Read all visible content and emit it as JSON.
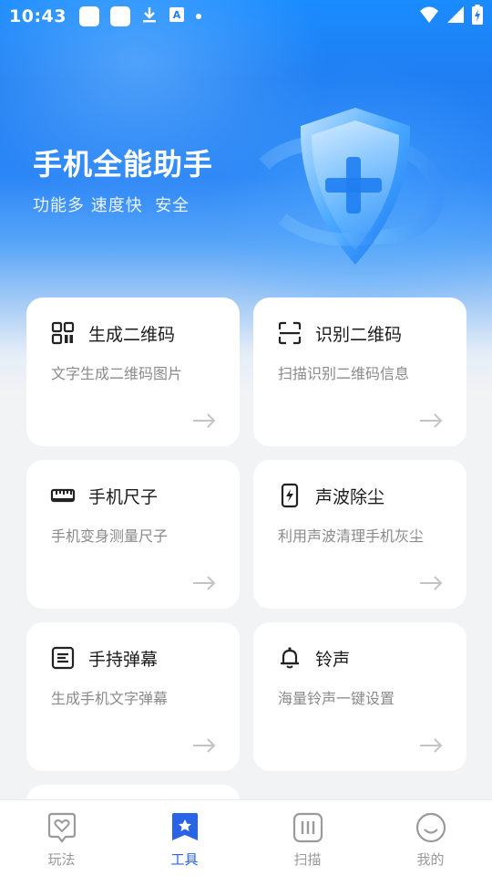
{
  "status_bar": {
    "time": "10:43",
    "left_icons": [
      "app-square-icon",
      "app-square-icon",
      "download-icon",
      "a-text-icon",
      "dot-icon"
    ],
    "right_icons": [
      "wifi-icon",
      "signal-icon",
      "battery-charging-icon"
    ]
  },
  "hero": {
    "title": "手机全能助手",
    "subtitle": "功能多 速度快  安全",
    "illustration": "shield-plus-icon"
  },
  "tools": [
    {
      "icon": "qr-code-icon",
      "title": "生成二维码",
      "desc": "文字生成二维码图片"
    },
    {
      "icon": "scan-qr-icon",
      "title": "识别二维码",
      "desc": "扫描识别二维码信息"
    },
    {
      "icon": "ruler-icon",
      "title": "手机尺子",
      "desc": "手机变身测量尺子"
    },
    {
      "icon": "phone-lightning-icon",
      "title": "声波除尘",
      "desc": "利用声波清理手机灰尘"
    },
    {
      "icon": "barrage-icon",
      "title": "手持弹幕",
      "desc": "生成手机文字弹幕"
    },
    {
      "icon": "bell-icon",
      "title": "铃声",
      "desc": "海量铃声一键设置"
    }
  ],
  "tabbar": {
    "items": [
      {
        "label": "玩法",
        "icon": "heart-chat-icon",
        "active": false
      },
      {
        "label": "工具",
        "icon": "star-bookmark-icon",
        "active": true
      },
      {
        "label": "扫描",
        "icon": "scan-bars-icon",
        "active": false
      },
      {
        "label": "我的",
        "icon": "smile-face-icon",
        "active": false
      }
    ]
  },
  "colors": {
    "brand_blue": "#1f7ef2",
    "tab_active": "#2a63e6",
    "tab_inactive": "#9a9a9a",
    "background": "#f2f3f5"
  }
}
